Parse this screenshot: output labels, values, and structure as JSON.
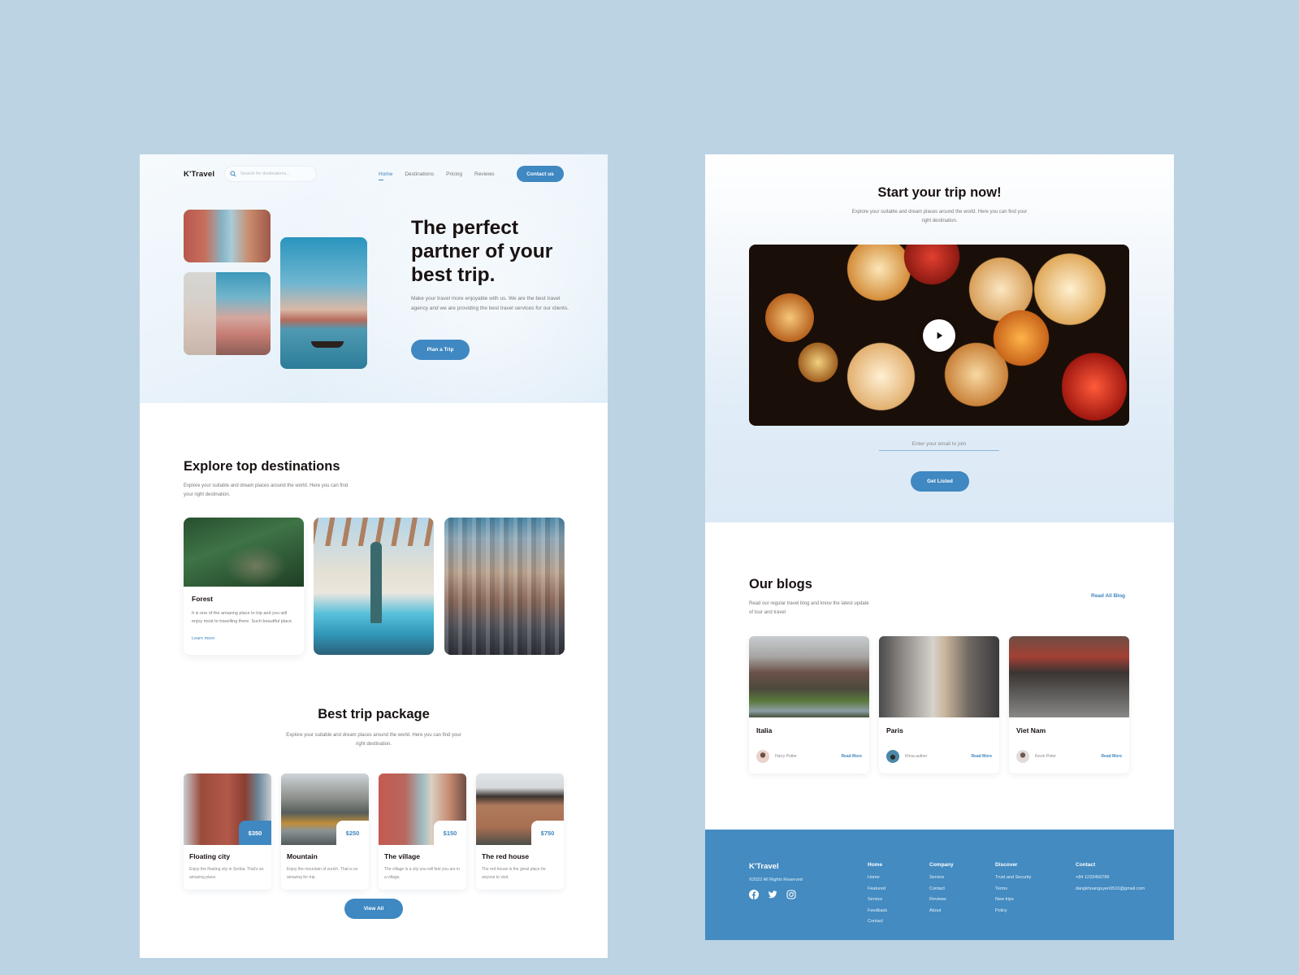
{
  "header": {
    "logo": "K'Travel",
    "search_placeholder": "Search for destinations...",
    "nav": [
      {
        "label": "Home",
        "active": true
      },
      {
        "label": "Destinations",
        "active": false
      },
      {
        "label": "Pricing",
        "active": false
      },
      {
        "label": "Reviews",
        "active": false
      }
    ],
    "contact_label": "Contact us"
  },
  "hero": {
    "title": "The perfect partner of your best trip.",
    "description": "Make your travel more enjoyable with us. We are the best travel agency and we are providing the best travel services for our clients.",
    "cta_label": "Plan a Trip"
  },
  "explore": {
    "title": "Explore top destinations",
    "description": "Explore your suitable and dream places around the world. Here you can find your right destination.",
    "featured": {
      "name": "Forest",
      "description": "It is one of the amazing place to trip and you will enjoy most to travelling there. Such beautiful place.",
      "link": "Learn more"
    }
  },
  "packages": {
    "title": "Best trip package",
    "description": "Explore your suitable and dream places around the world. Here you can find your right destination.",
    "items": [
      {
        "name": "Floating city",
        "price": "$350",
        "description": "Enjoy the floating city in Serbia. That's an amazing place."
      },
      {
        "name": "Mountain",
        "price": "$250",
        "description": "Enjoy the mountain of zurich. That is so amazing for trip."
      },
      {
        "name": "The village",
        "price": "$150",
        "description": "The village is a city you will feel you are in a village."
      },
      {
        "name": "The red house",
        "price": "$750",
        "description": "The red house is the great place for anyone to visit."
      }
    ],
    "view_all_label": "View All"
  },
  "trip_now": {
    "title": "Start your trip now!",
    "description": "Explore your suitable and dream places around the world. Here you can find your right destination.",
    "email_placeholder": "Enter your email to join",
    "cta_label": "Get Listed"
  },
  "blogs": {
    "title": "Our blogs",
    "description": "Read our regular travel blog and know the latest update of tour and travel",
    "read_all": "Read All Blog",
    "items": [
      {
        "name": "Italia",
        "author": "Harry Potter",
        "link": "Read More"
      },
      {
        "name": "Paris",
        "author": "Khoa.author",
        "link": "Read More"
      },
      {
        "name": "Viet Nam",
        "author": "Kevin Peter",
        "link": "Read More"
      }
    ]
  },
  "footer": {
    "logo": "K'Travel",
    "copyright": "©2022 All Rights Reserved",
    "social": [
      "facebook-icon",
      "twitter-icon",
      "instagram-icon"
    ],
    "columns": [
      {
        "heading": "Home",
        "links": [
          "Home",
          "Featured",
          "Service",
          "Feedback",
          "Contact"
        ]
      },
      {
        "heading": "Company",
        "links": [
          "Service",
          "Contact",
          "Reviews",
          "About"
        ]
      },
      {
        "heading": "Discover",
        "links": [
          "Trust and Security",
          "Terms",
          "New trips",
          "Policy"
        ]
      },
      {
        "heading": "Contact",
        "links": [
          "+84 1233456789",
          "dangkhoanguyen0510@gmail.com"
        ]
      }
    ]
  },
  "colors": {
    "accent": "#3f88c2",
    "footer_bg": "#438bc1",
    "page_bg": "#bcd3e3",
    "heading": "#1a1212"
  }
}
